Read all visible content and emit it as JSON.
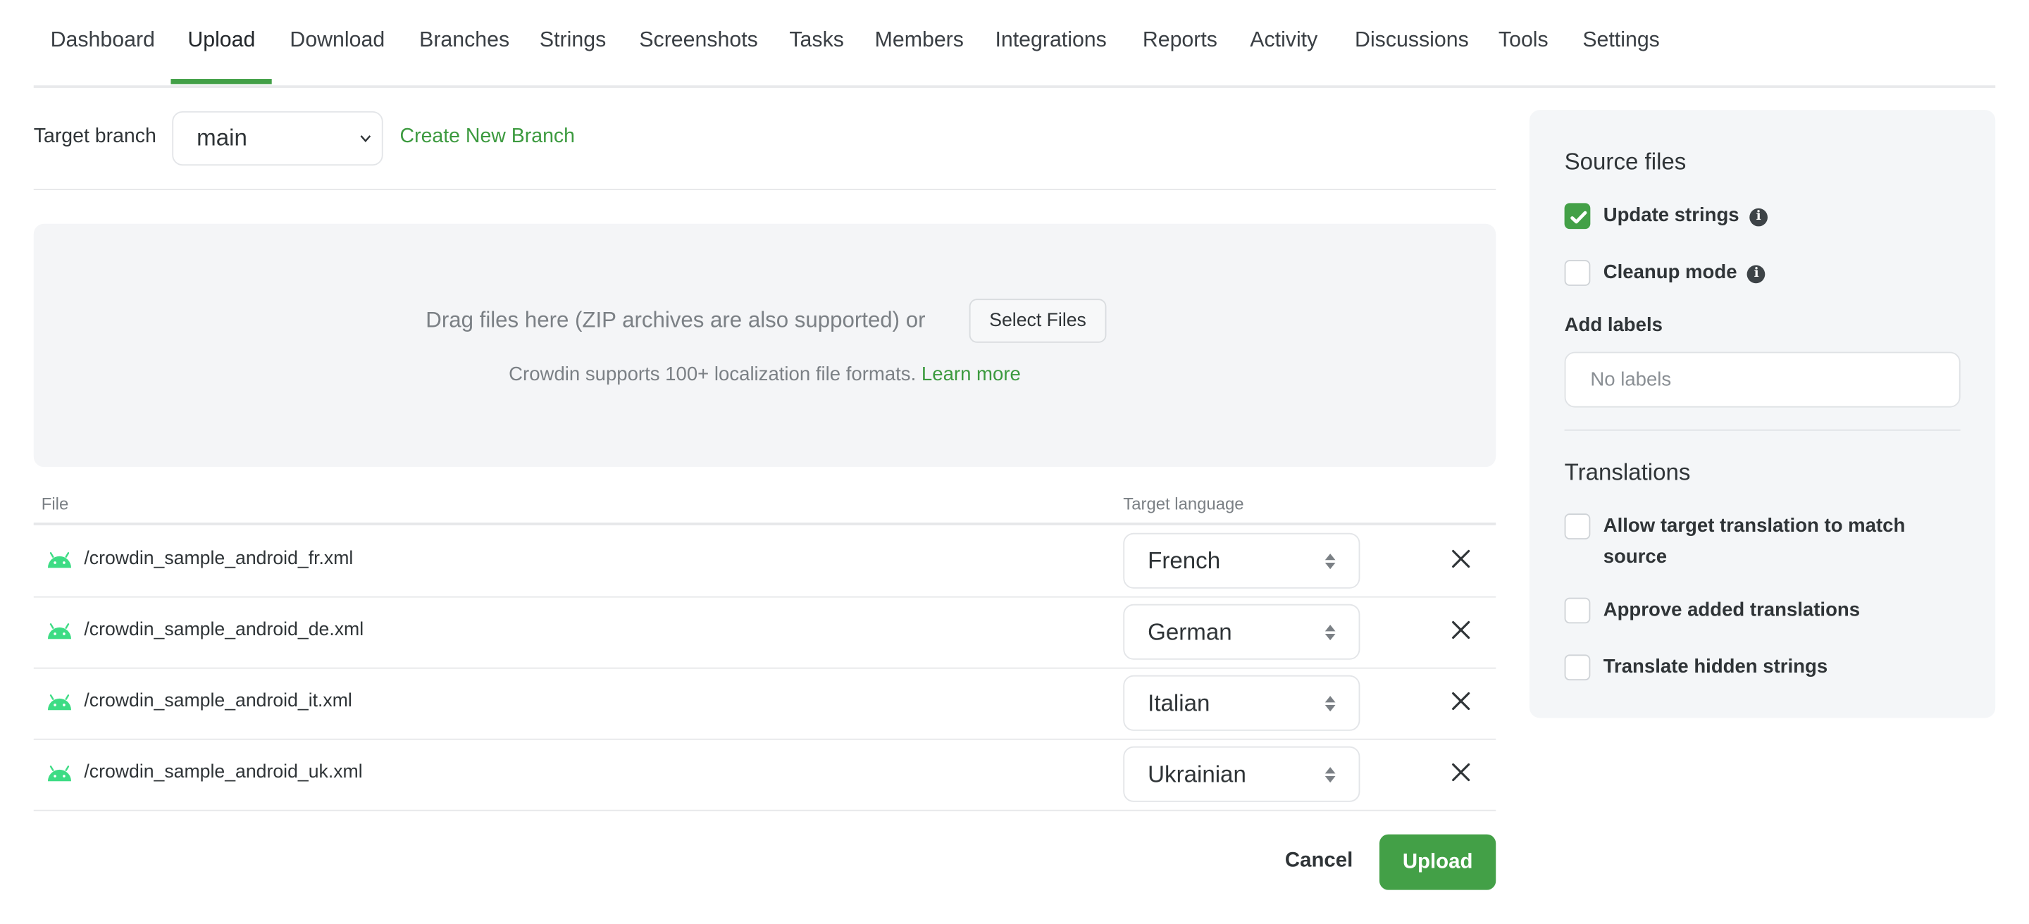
{
  "nav": {
    "items": [
      {
        "label": "Dashboard"
      },
      {
        "label": "Upload",
        "active": true
      },
      {
        "label": "Download"
      },
      {
        "label": "Branches"
      },
      {
        "label": "Strings"
      },
      {
        "label": "Screenshots"
      },
      {
        "label": "Tasks"
      },
      {
        "label": "Members"
      },
      {
        "label": "Integrations"
      },
      {
        "label": "Reports"
      },
      {
        "label": "Activity"
      },
      {
        "label": "Discussions"
      },
      {
        "label": "Tools"
      },
      {
        "label": "Settings"
      }
    ]
  },
  "branch": {
    "label": "Target branch",
    "value": "main",
    "create_link": "Create New Branch"
  },
  "dropzone": {
    "text": "Drag files here (ZIP archives are also supported) or",
    "select_button": "Select Files",
    "formats_text": "Crowdin supports 100+ localization file formats.",
    "learn_more": "Learn more"
  },
  "table": {
    "headers": {
      "file": "File",
      "language": "Target language"
    },
    "rows": [
      {
        "file": "/crowdin_sample_android_fr.xml",
        "language": "French",
        "icon": "android-icon"
      },
      {
        "file": "/crowdin_sample_android_de.xml",
        "language": "German",
        "icon": "android-icon"
      },
      {
        "file": "/crowdin_sample_android_it.xml",
        "language": "Italian",
        "icon": "android-icon"
      },
      {
        "file": "/crowdin_sample_android_uk.xml",
        "language": "Ukrainian",
        "icon": "android-icon"
      }
    ]
  },
  "actions": {
    "cancel": "Cancel",
    "upload": "Upload"
  },
  "panel": {
    "source_title": "Source files",
    "update_strings": {
      "label": "Update strings",
      "checked": true
    },
    "cleanup_mode": {
      "label": "Cleanup mode",
      "checked": false
    },
    "labels_title": "Add labels",
    "labels_placeholder": "No labels",
    "translations_title": "Translations",
    "allow_match": {
      "label_line1": "Allow target translation to match",
      "label_line2": "source",
      "checked": false
    },
    "approve_added": {
      "label": "Approve added translations",
      "checked": false
    },
    "translate_hidden": {
      "label": "Translate hidden strings",
      "checked": false
    }
  },
  "colors": {
    "accent": "#43a047",
    "android": "#3ddc84",
    "panel_bg": "#f4f6f8"
  }
}
